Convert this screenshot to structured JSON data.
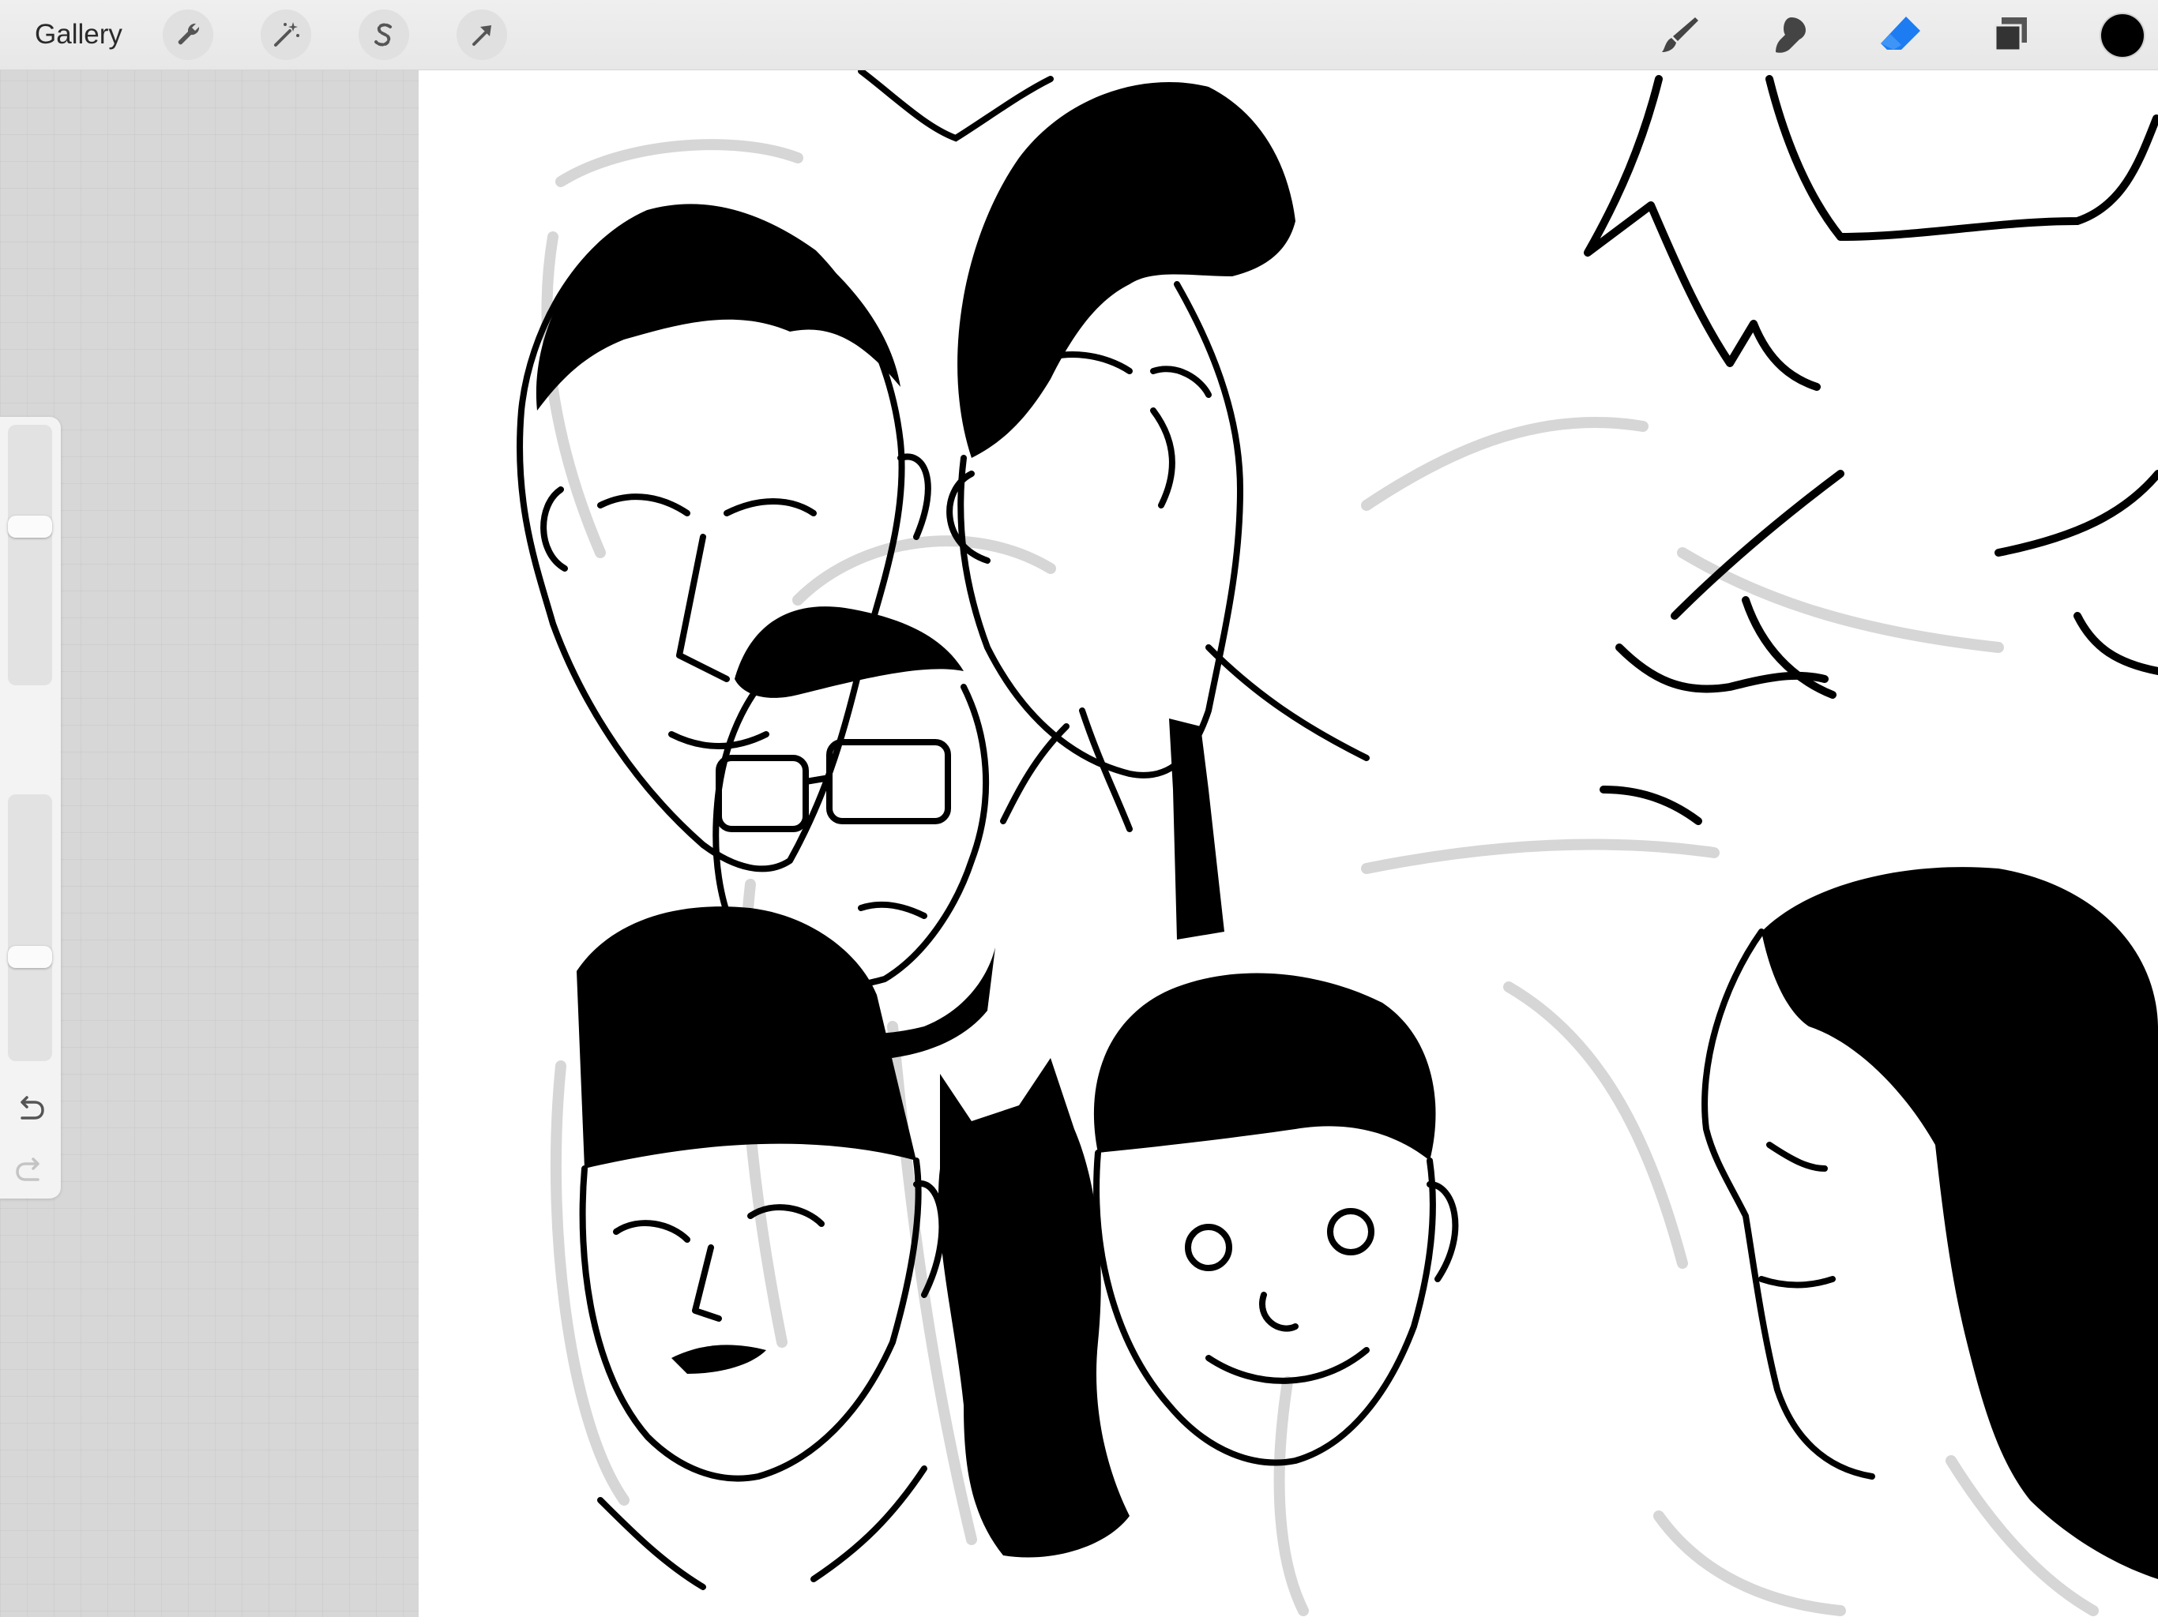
{
  "toolbar": {
    "gallery_label": "Gallery",
    "left_tools": [
      {
        "name": "actions",
        "icon": "wrench-icon"
      },
      {
        "name": "adjustments",
        "icon": "magic-wand-icon"
      },
      {
        "name": "selection",
        "icon": "selection-s-icon"
      },
      {
        "name": "transform",
        "icon": "arrow-cursor-icon"
      }
    ],
    "right_tools": [
      {
        "name": "brush",
        "icon": "brush-icon",
        "active": false
      },
      {
        "name": "smudge",
        "icon": "smudge-icon",
        "active": false
      },
      {
        "name": "eraser",
        "icon": "eraser-icon",
        "active": true
      },
      {
        "name": "layers",
        "icon": "layers-icon",
        "active": false
      }
    ],
    "active_color": "#000000"
  },
  "sidebar": {
    "brush_size": 0.62,
    "opacity": 0.38,
    "undo_icon": "undo-arrow-icon",
    "redo_icon": "redo-arrow-icon"
  },
  "colors": {
    "accent": "#1d7cf2",
    "ink": "#000000",
    "sketch_gray": "#d2d2d2",
    "workspace": "#d7d7d7"
  }
}
